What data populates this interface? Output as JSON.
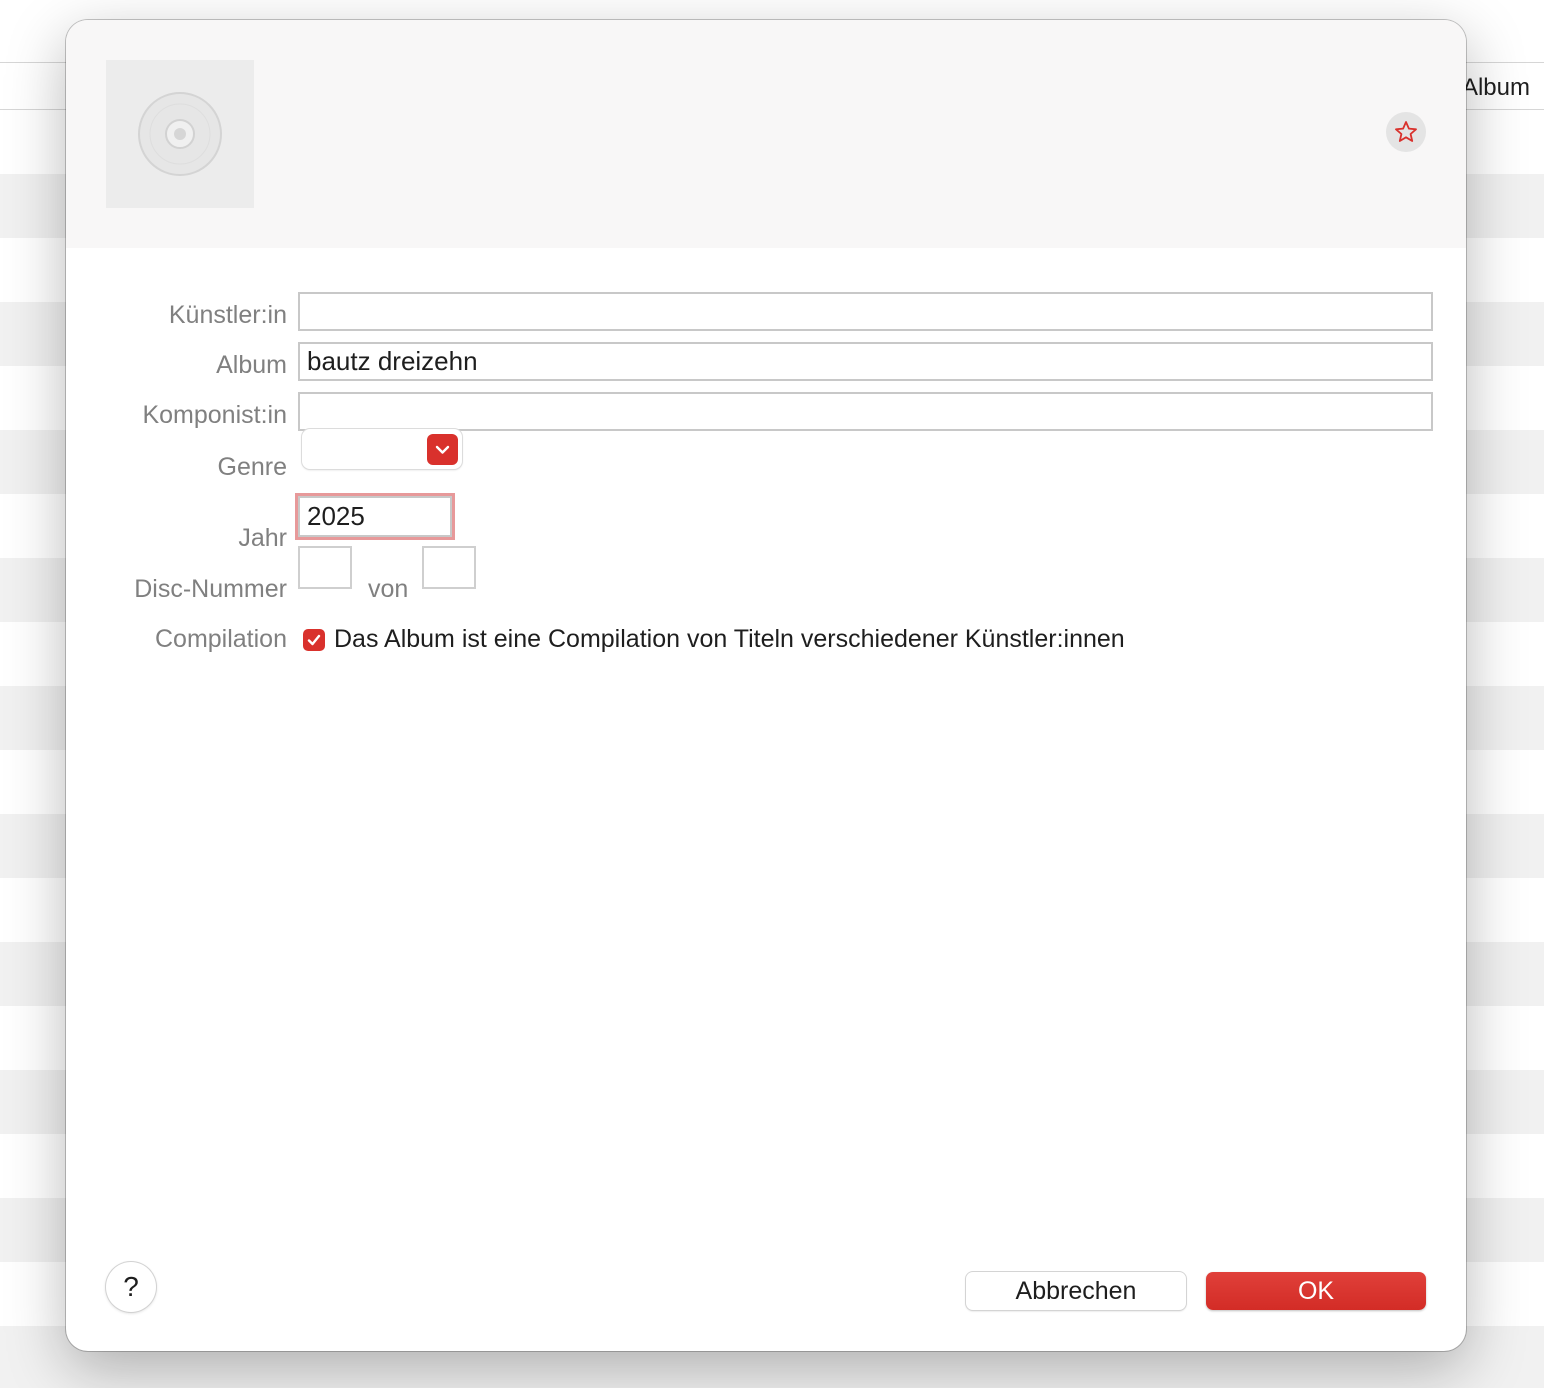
{
  "background": {
    "column_header": "Album"
  },
  "dialog": {
    "labels": {
      "artist": "Künstler:in",
      "album": "Album",
      "composer": "Komponist:in",
      "genre": "Genre",
      "year": "Jahr",
      "disc_number": "Disc-Nummer",
      "disc_of": "von",
      "compilation": "Compilation"
    },
    "fields": {
      "artist": "",
      "album": "bautz dreizehn",
      "composer": "",
      "genre": "",
      "year": "2025",
      "disc_number": "",
      "disc_count": ""
    },
    "compilation": {
      "checked": true,
      "text": "Das Album ist eine Compilation von Titeln verschiedener Künstler:innen"
    },
    "buttons": {
      "help": "?",
      "cancel": "Abbrechen",
      "ok": "OK"
    },
    "icons": {
      "artwork": "cd-disc-icon",
      "favorite": "star-icon",
      "genre_dropdown": "chevron-down-icon",
      "checkbox": "checkmark-icon"
    },
    "colors": {
      "accent": "#d9312c",
      "label": "#808080",
      "focus_ring": "#e7999a"
    }
  }
}
